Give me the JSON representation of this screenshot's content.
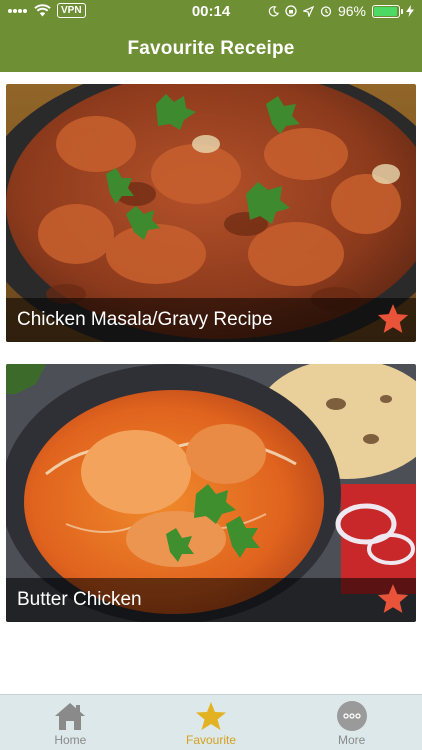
{
  "status_bar": {
    "vpn": "VPN",
    "time": "00:14",
    "battery": "96%",
    "battery_level": 0.96
  },
  "header": {
    "title": "Favourite Receipe",
    "color": "#6f8f35"
  },
  "favourites": [
    {
      "title": "Chicken Masala/Gravy Recipe",
      "favourite": true
    },
    {
      "title": "Butter Chicken",
      "favourite": true
    }
  ],
  "tabbar": {
    "tabs": [
      {
        "label": "Home",
        "icon": "home-icon",
        "active": false
      },
      {
        "label": "Favourite",
        "icon": "star-icon",
        "active": true
      },
      {
        "label": "More",
        "icon": "more-icon",
        "active": false
      }
    ],
    "active_color": "#d4a21d",
    "inactive_color": "#8a8a8a"
  },
  "colors": {
    "star": "#e8533a"
  }
}
